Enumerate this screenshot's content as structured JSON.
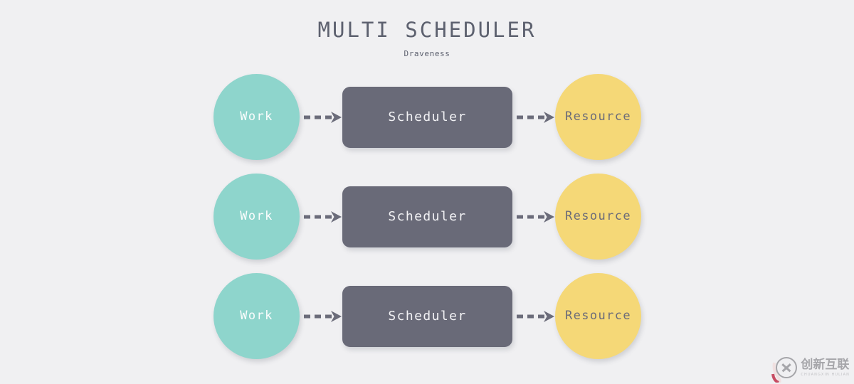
{
  "header": {
    "title": "MULTI SCHEDULER",
    "subtitle": "Draveness"
  },
  "colors": {
    "background": "#f0f0f2",
    "work_circle": "#8ed5cc",
    "scheduler_box": "#696a78",
    "resource_circle": "#f5d877",
    "title_text": "#5d616f",
    "arrow": "#6b6c7a",
    "work_label_text": "#fbfdfd",
    "scheduler_label_text": "#f2f2f5",
    "resource_label_text": "#6c6c79"
  },
  "diagram": {
    "type": "flow",
    "rows": [
      {
        "work": "Work",
        "scheduler": "Scheduler",
        "resource": "Resource",
        "arrow_1": "dashed-arrow-right",
        "arrow_2": "dashed-arrow-right"
      },
      {
        "work": "Work",
        "scheduler": "Scheduler",
        "resource": "Resource",
        "arrow_1": "dashed-arrow-right",
        "arrow_2": "dashed-arrow-right"
      },
      {
        "work": "Work",
        "scheduler": "Scheduler",
        "resource": "Resource",
        "arrow_1": "dashed-arrow-right",
        "arrow_2": "dashed-arrow-right"
      }
    ]
  },
  "watermark": {
    "cn": "创新互联",
    "en": "CHUANGXIN HULIAN",
    "mark": "circled-x-logo"
  }
}
